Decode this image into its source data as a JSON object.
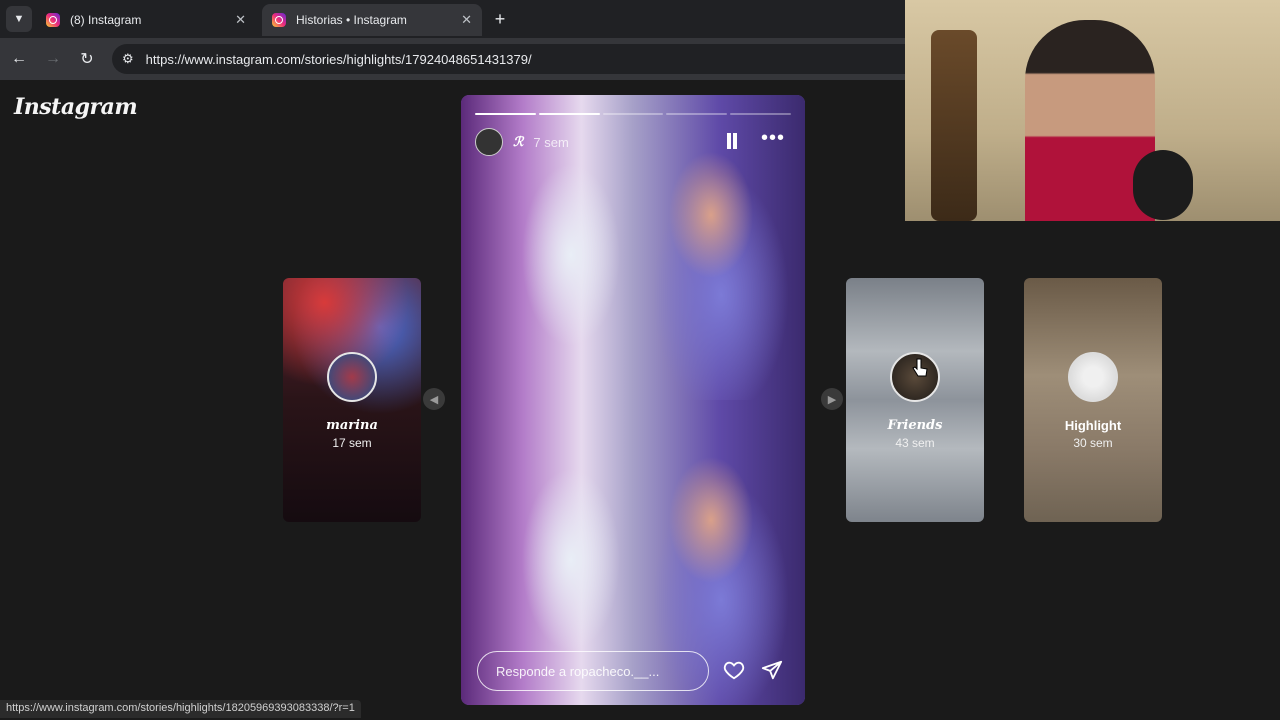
{
  "browser": {
    "tabs": [
      {
        "title": "(8) Instagram",
        "active": false
      },
      {
        "title": "Historias • Instagram",
        "active": true
      }
    ],
    "url": "https://www.instagram.com/stories/highlights/17924048651431379/",
    "status_url": "https://www.instagram.com/stories/highlights/18205969393083338/?r=1"
  },
  "page": {
    "logo": "Instagram",
    "story": {
      "username": "ℛ",
      "time": "7 sem",
      "reply_placeholder": "Responde a ropacheco.__...",
      "segments_total": 5,
      "segments_done": 2
    },
    "highlights": [
      {
        "name": "marina",
        "time": "17 sem"
      },
      {
        "name": "Friends",
        "time": "43 sem"
      },
      {
        "name": "Highlight",
        "time": "30 sem"
      }
    ]
  },
  "colors": {
    "instagram_accent": "#ee2a7b",
    "page_bg": "#1a1a1a"
  }
}
